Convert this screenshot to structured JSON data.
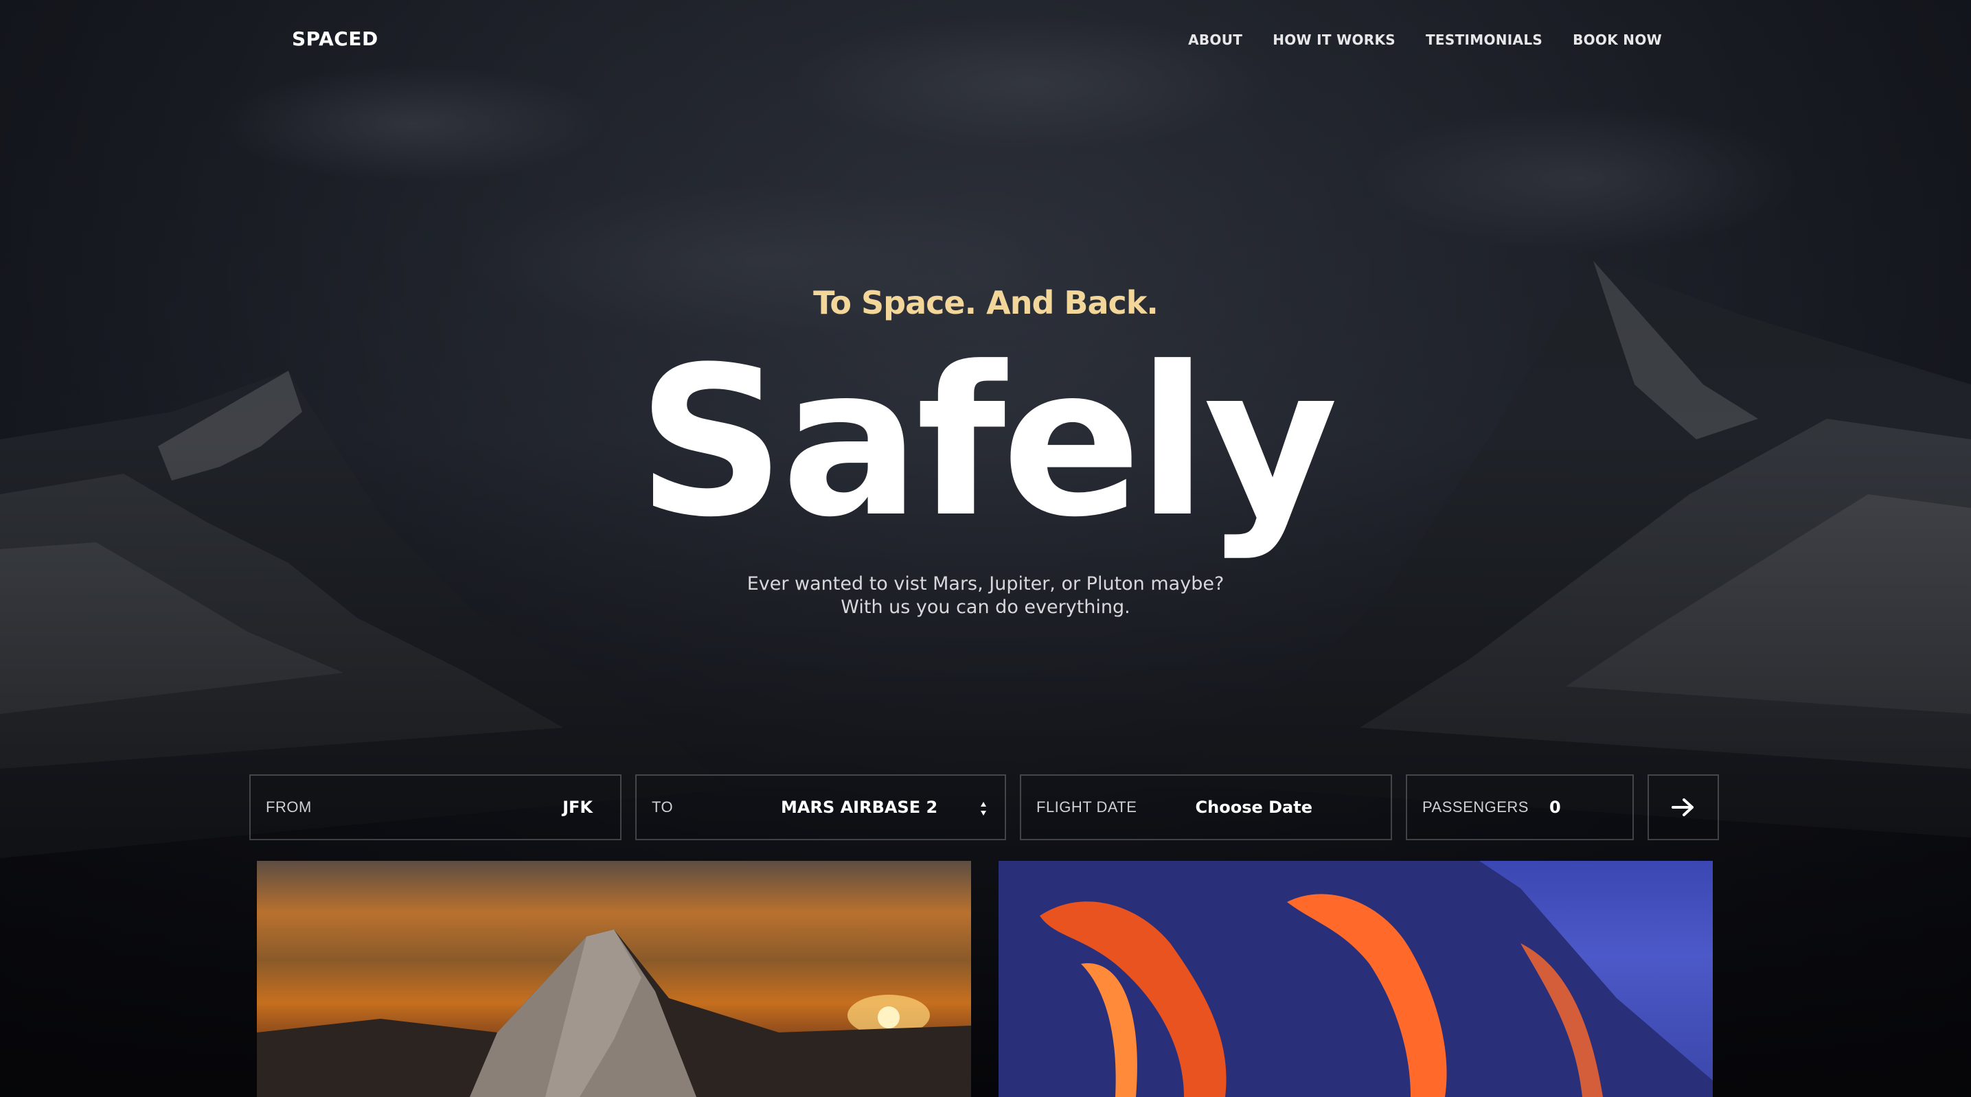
{
  "brand": {
    "logo": "SPACED"
  },
  "nav": {
    "links": [
      "ABOUT",
      "HOW IT WORKS",
      "TESTIMONIALS",
      "BOOK NOW"
    ]
  },
  "hero": {
    "tagline": "To Space. And Back.",
    "headline": "Safely",
    "subtext_line1": "Ever wanted to vist Mars, Jupiter, or Pluton maybe?",
    "subtext_line2": "With us you can do everything."
  },
  "booking": {
    "from_label": "FROM",
    "from_value": "JFK",
    "to_label": "TO",
    "to_value": "MARS AIRBASE 2",
    "date_label": "FLIGHT DATE",
    "date_value": "Choose Date",
    "passengers_label": "PASSENGERS",
    "passengers_value": "0",
    "submit_icon": "arrow-right-icon"
  },
  "cards": [
    {
      "image": "mountain-sunset"
    },
    {
      "image": "lava-flow"
    }
  ],
  "colors": {
    "accent_tagline": "#f3d69a",
    "text": "#ffffff",
    "border": "rgba(255,255,255,0.22)"
  }
}
